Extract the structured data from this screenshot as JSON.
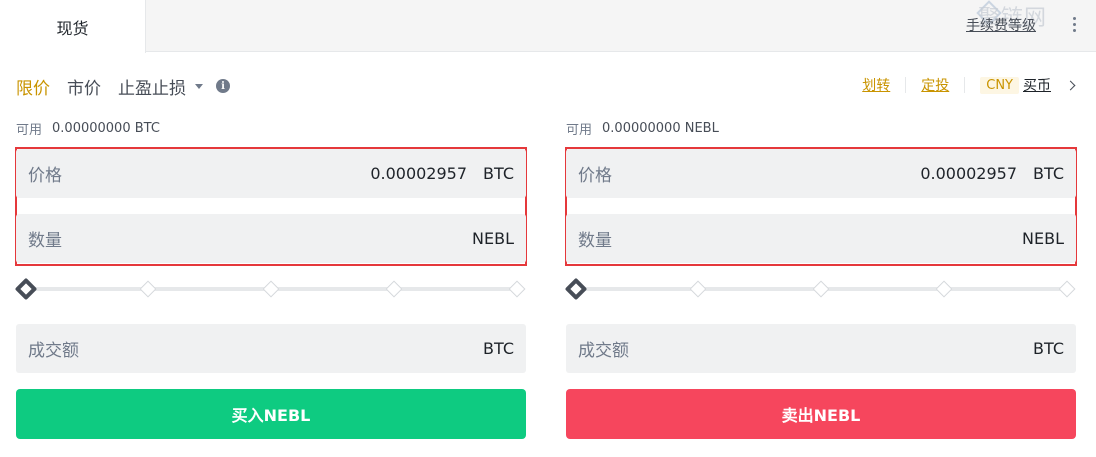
{
  "header": {
    "tab_spot": "现货",
    "fee_link": "手续费等级",
    "watermark": "聚链网"
  },
  "order_types": {
    "limit": "限价",
    "market": "市价",
    "stop": "止盈止损"
  },
  "links": {
    "transfer": "划转",
    "recurring": "定投",
    "currency": "CNY",
    "buy_coin": "买币"
  },
  "buy_panel": {
    "available_label": "可用",
    "available_value": "0.00000000 BTC",
    "price_label": "价格",
    "price_value": "0.00002957",
    "price_unit": "BTC",
    "qty_label": "数量",
    "qty_unit": "NEBL",
    "total_label": "成交额",
    "total_unit": "BTC",
    "button": "买入NEBL",
    "slider_percent": 0
  },
  "sell_panel": {
    "available_label": "可用",
    "available_value": "0.00000000 NEBL",
    "price_label": "价格",
    "price_value": "0.00002957",
    "price_unit": "BTC",
    "qty_label": "数量",
    "qty_unit": "NEBL",
    "total_label": "成交额",
    "total_unit": "BTC",
    "button": "卖出NEBL",
    "slider_percent": 0
  },
  "colors": {
    "accent": "#c99400",
    "buy": "#0ecb81",
    "sell": "#f6465d",
    "highlight_border": "#e5383b"
  }
}
